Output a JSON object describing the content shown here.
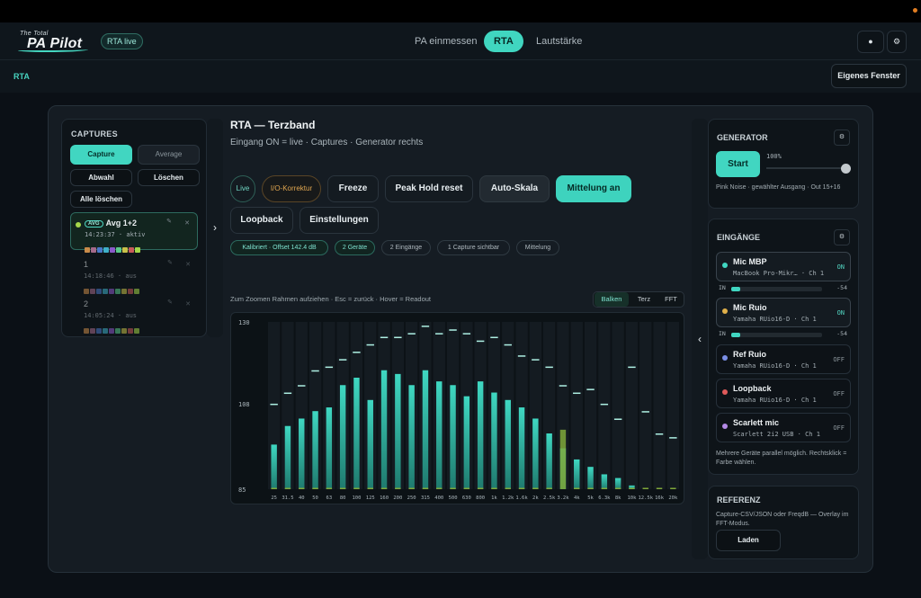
{
  "app": {
    "logo_sub": "The Total",
    "logo_main": "PA Pilot",
    "live_badge": "RTA live"
  },
  "nav": {
    "tabs": [
      {
        "label": "PA einmessen",
        "active": false
      },
      {
        "label": "RTA",
        "active": true
      },
      {
        "label": "Lautstärke",
        "active": false
      }
    ],
    "theme_icon": "sun-icon",
    "settings_icon": "gear-icon"
  },
  "subbar": {
    "label": "RTA",
    "window_button": "Eigenes Fenster"
  },
  "captures": {
    "heading": "CAPTURES",
    "btn_capture": "Capture",
    "btn_average": "Average",
    "btn_select": "Abwahl",
    "btn_delete": "Löschen",
    "btn_delete_all": "Alle löschen",
    "items": [
      {
        "tag": "AVG",
        "title": "Avg 1+2",
        "time": "14:23:37",
        "status": "aktiv",
        "dot": "#a5d64a"
      },
      {
        "tag": "",
        "title": "1",
        "time": "14:18:46",
        "status": "aus",
        "dot": ""
      },
      {
        "tag": "",
        "title": "2",
        "time": "14:05:24",
        "status": "aus",
        "dot": ""
      }
    ],
    "edit_icon": "pencil-icon",
    "close_icon": "close-icon"
  },
  "rta": {
    "title": "RTA — Terzband",
    "subtitle": "Eingang ON = live · Captures · Generator rechts",
    "toolbar": {
      "live": "Live",
      "io": "I/O-Korrektur",
      "freeze": "Freeze",
      "peak_reset": "Peak Hold reset",
      "auto_scale": "Auto-Skala",
      "averaging": "Mittelung an",
      "loopback": "Loopback",
      "settings": "Einstellungen"
    },
    "chips": [
      {
        "label": "Kalibriert · Offset 142.4 dB",
        "green": true
      },
      {
        "label": "2 Geräte",
        "green": true
      },
      {
        "label": "2 Eingänge",
        "green": false
      },
      {
        "label": "1 Capture sichtbar",
        "green": false
      },
      {
        "label": "Mittelung",
        "green": false
      }
    ],
    "hint": "Zum Zoomen Rahmen aufziehen · Esc = zurück · Hover = Readout",
    "view_modes": [
      {
        "label": "Balken",
        "on": true
      },
      {
        "label": "Terz",
        "on": false
      },
      {
        "label": "FFT",
        "on": false
      }
    ]
  },
  "chart_data": {
    "type": "bar",
    "categories": [
      "25",
      "31.5",
      "40",
      "50",
      "63",
      "80",
      "100",
      "125",
      "160",
      "200",
      "250",
      "315",
      "400",
      "500",
      "630",
      "800",
      "1k",
      "1.2k",
      "1.6k",
      "2k",
      "2.5k",
      "3.2k",
      "4k",
      "5k",
      "6.3k",
      "8k",
      "10k",
      "12.5k",
      "16k",
      "20k"
    ],
    "series": [
      {
        "values": [
          97,
          102,
          104,
          106,
          107,
          113,
          115,
          109,
          117,
          116,
          113,
          117,
          114,
          113,
          110,
          114,
          111,
          109,
          107,
          104,
          100,
          96,
          93,
          91,
          89,
          88,
          86,
          85,
          85,
          85
        ]
      },
      {
        "values": [
          85,
          85,
          85,
          85,
          85,
          85,
          85,
          85,
          85,
          85,
          85,
          85,
          85,
          85,
          85,
          85,
          85,
          85,
          85,
          85,
          85,
          101,
          85,
          85,
          85,
          85,
          85,
          85,
          85,
          85
        ]
      }
    ],
    "peak_hold": [
      108,
      111,
      113,
      117,
      118,
      120,
      122,
      124,
      126,
      126,
      127,
      129,
      127,
      128,
      127,
      125,
      126,
      124,
      121,
      120,
      118,
      113,
      111,
      112,
      108,
      104,
      118,
      106,
      100,
      99
    ],
    "ylim": [
      85,
      130
    ],
    "yticks": [
      85,
      108,
      130
    ],
    "colors": {
      "series": "#3fd8c2",
      "capture": "#7fa83a",
      "peak": "#aef0e3"
    },
    "grid": true
  },
  "generator": {
    "heading": "GENERATOR",
    "start": "Start",
    "level": "100%",
    "level_value": 1.0,
    "note": "Pink Noise · gewählter Ausgang · Out 15+16"
  },
  "inputs": {
    "heading": "EINGÄNGE",
    "items": [
      {
        "name": "Mic MBP",
        "device": "MacBook Pro-Mikr… · Ch 1",
        "state": "ON",
        "color": "#40d6c1",
        "meter_label": "IN",
        "meter_value": "-54",
        "level": 0.1
      },
      {
        "name": "Mic Ruio",
        "device": "Yamaha RUio16-D · Ch 1",
        "state": "ON",
        "color": "#e0b04a",
        "meter_label": "IN",
        "meter_value": "-54",
        "level": 0.1
      },
      {
        "name": "Ref Ruio",
        "device": "Yamaha RUio16-D · Ch 1",
        "state": "OFF",
        "color": "#7b8fe6"
      },
      {
        "name": "Loopback",
        "device": "Yamaha RUio16-D · Ch 1",
        "state": "OFF",
        "color": "#e05a5a"
      },
      {
        "name": "Scarlett mic",
        "device": "Scarlett 2i2 USB · Ch 1",
        "state": "OFF",
        "color": "#b48ae6"
      }
    ],
    "note": "Mehrere Geräte parallel möglich. Rechtsklick = Farbe wählen."
  },
  "reference": {
    "heading": "REFERENZ",
    "note": "Capture-CSV/JSON oder FreqdB — Overlay im FFT-Modus.",
    "load": "Laden"
  }
}
